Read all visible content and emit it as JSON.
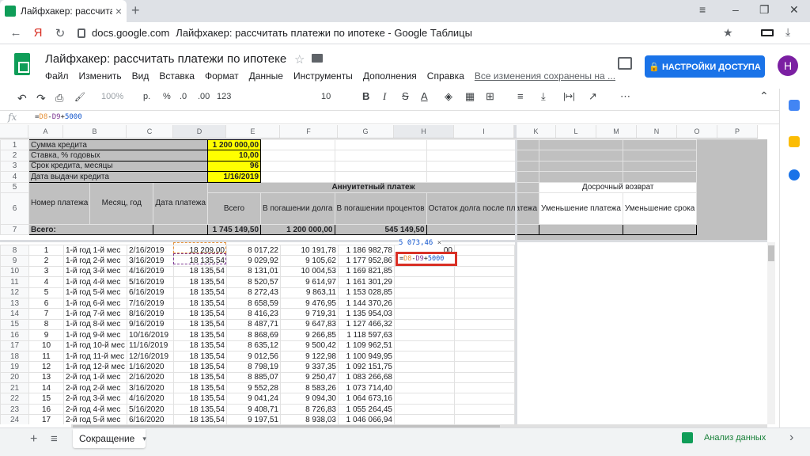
{
  "browser": {
    "tab_title": "Лайфхакер: рассчитать",
    "tab_close": "×",
    "new_tab": "+",
    "window_controls": [
      "≡",
      "–",
      "❐",
      "✕"
    ],
    "back": "←",
    "yandex": "Я",
    "reload": "↻",
    "domain": "docs.google.com",
    "page_title": "Лайфхакер: рассчитать платежи по ипотеке - Google Таблицы",
    "bookmark": "★",
    "download": "⤓"
  },
  "sheets": {
    "doc_title": "Лайфхакер: рассчитать платежи по ипотеке",
    "star": "☆",
    "menu": [
      "Файл",
      "Изменить",
      "Вид",
      "Вставка",
      "Формат",
      "Данные",
      "Инструменты",
      "Дополнения",
      "Справка"
    ],
    "saved_status": "Все изменения сохранены на ...",
    "share_label": "🔒 НАСТРОЙКИ ДОСТУПА",
    "avatar_letter": "H",
    "toolbar": {
      "undo": "↶",
      "redo": "↷",
      "print": "⎙",
      "paint": "🖌",
      "zoom": "100%",
      "currency": "р.",
      "percent": "%",
      "dec_less": ".0",
      "dec_more": ".00",
      "format": "123",
      "font": "",
      "font_size": "10",
      "bold": "B",
      "italic": "I",
      "strike": "S",
      "textcolor": "A",
      "fill": "◈",
      "borders": "▦",
      "merge": "⊞",
      "halign": "≡",
      "valign": "⤓",
      "wrap": "|↦|",
      "rotate": "↗",
      "more": "⋯",
      "collapse": "⌃"
    },
    "formula_bar": {
      "fx": "fx",
      "parts": [
        "=",
        "D8",
        "-",
        "D9",
        "+",
        "5000"
      ]
    },
    "columns": [
      "A",
      "B",
      "C",
      "D",
      "E",
      "F",
      "G",
      "H",
      "I",
      "K",
      "L",
      "M",
      "N",
      "O",
      "P"
    ],
    "rows": {
      "r1": {
        "n": "1",
        "label": "Сумма кредита",
        "value": "1 200 000,00"
      },
      "r2": {
        "n": "2",
        "label": "Ставка, % годовых",
        "value": "10,00"
      },
      "r3": {
        "n": "3",
        "label": "Срок кредита, месяцы",
        "value": "96"
      },
      "r4": {
        "n": "4",
        "label": "Дата выдачи кредита",
        "value": "1/16/2019"
      },
      "r5": {
        "n": "5",
        "annuity": "Аннуитетный платеж",
        "early": "Досрочный возврат"
      },
      "r6": {
        "n": "6",
        "a": "Номер платежа",
        "b": "Месяц, год",
        "c": "Дата платежа",
        "d": "Всего",
        "e": "В погашении долга",
        "f": "В погашении процентов",
        "g": "Остаток долга после платежа",
        "h": "Уменьшение платежа",
        "i": "Уменьшение срока"
      },
      "r7": {
        "n": "7",
        "a": "Всего:",
        "d": "1 745 149,50",
        "e": "1 200 000,00",
        "f": "545 149,50"
      }
    },
    "data_rows": [
      {
        "n": "8",
        "a": "1",
        "b": "1-й год 1-й мес",
        "c": "2/16/2019",
        "d": "18 209,00",
        "e": "8 017,22",
        "f": "10 191,78",
        "g": "1 186 982,78",
        "h": "00"
      },
      {
        "n": "9",
        "a": "2",
        "b": "1-й год 2-й мес",
        "c": "3/16/2019",
        "d": "18 135,54",
        "e": "9 029,92",
        "f": "9 105,62",
        "g": "1 177 952,86",
        "h": ""
      },
      {
        "n": "10",
        "a": "3",
        "b": "1-й год 3-й мес",
        "c": "4/16/2019",
        "d": "18 135,54",
        "e": "8 131,01",
        "f": "10 004,53",
        "g": "1 169 821,85",
        "h": ""
      },
      {
        "n": "11",
        "a": "4",
        "b": "1-й год 4-й мес",
        "c": "5/16/2019",
        "d": "18 135,54",
        "e": "8 520,57",
        "f": "9 614,97",
        "g": "1 161 301,29",
        "h": ""
      },
      {
        "n": "12",
        "a": "5",
        "b": "1-й год 5-й мес",
        "c": "6/16/2019",
        "d": "18 135,54",
        "e": "8 272,43",
        "f": "9 863,11",
        "g": "1 153 028,85",
        "h": ""
      },
      {
        "n": "13",
        "a": "6",
        "b": "1-й год 6-й мес",
        "c": "7/16/2019",
        "d": "18 135,54",
        "e": "8 658,59",
        "f": "9 476,95",
        "g": "1 144 370,26",
        "h": ""
      },
      {
        "n": "14",
        "a": "7",
        "b": "1-й год 7-й мес",
        "c": "8/16/2019",
        "d": "18 135,54",
        "e": "8 416,23",
        "f": "9 719,31",
        "g": "1 135 954,03",
        "h": ""
      },
      {
        "n": "15",
        "a": "8",
        "b": "1-й год 8-й мес",
        "c": "9/16/2019",
        "d": "18 135,54",
        "e": "8 487,71",
        "f": "9 647,83",
        "g": "1 127 466,32",
        "h": ""
      },
      {
        "n": "16",
        "a": "9",
        "b": "1-й год 9-й мес",
        "c": "10/16/2019",
        "d": "18 135,54",
        "e": "8 868,69",
        "f": "9 266,85",
        "g": "1 118 597,63",
        "h": ""
      },
      {
        "n": "17",
        "a": "10",
        "b": "1-й год 10-й мес",
        "c": "11/16/2019",
        "d": "18 135,54",
        "e": "8 635,12",
        "f": "9 500,42",
        "g": "1 109 962,51",
        "h": ""
      },
      {
        "n": "18",
        "a": "11",
        "b": "1-й год 11-й мес",
        "c": "12/16/2019",
        "d": "18 135,54",
        "e": "9 012,56",
        "f": "9 122,98",
        "g": "1 100 949,95",
        "h": ""
      },
      {
        "n": "19",
        "a": "12",
        "b": "1-й год 12-й мес",
        "c": "1/16/2020",
        "d": "18 135,54",
        "e": "8 798,19",
        "f": "9 337,35",
        "g": "1 092 151,75",
        "h": ""
      },
      {
        "n": "20",
        "a": "13",
        "b": "2-й год 1-й мес",
        "c": "2/16/2020",
        "d": "18 135,54",
        "e": "8 885,07",
        "f": "9 250,47",
        "g": "1 083 266,68",
        "h": ""
      },
      {
        "n": "21",
        "a": "14",
        "b": "2-й год 2-й мес",
        "c": "3/16/2020",
        "d": "18 135,54",
        "e": "9 552,28",
        "f": "8 583,26",
        "g": "1 073 714,40",
        "h": ""
      },
      {
        "n": "22",
        "a": "15",
        "b": "2-й год 3-й мес",
        "c": "4/16/2020",
        "d": "18 135,54",
        "e": "9 041,24",
        "f": "9 094,30",
        "g": "1 064 673,16",
        "h": ""
      },
      {
        "n": "23",
        "a": "16",
        "b": "2-й год 4-й мес",
        "c": "5/16/2020",
        "d": "18 135,54",
        "e": "9 408,71",
        "f": "8 726,83",
        "g": "1 055 264,45",
        "h": ""
      },
      {
        "n": "24",
        "a": "17",
        "b": "2-й год 5-й мес",
        "c": "6/16/2020",
        "d": "18 135,54",
        "e": "9 197,51",
        "f": "8 938,03",
        "g": "1 046 066,94",
        "h": ""
      }
    ],
    "edit": {
      "tooltip": "5 073,46",
      "tooltip_close": "×",
      "parts": [
        "=",
        "D8",
        "-",
        "D9",
        "+",
        "5000"
      ]
    },
    "sheet_tab": "Сокращение",
    "sheet_tab_arrow": "▾",
    "add_sheet": "+",
    "all_sheets": "≡",
    "explore": "Анализ данных",
    "panel_toggle": "›"
  }
}
